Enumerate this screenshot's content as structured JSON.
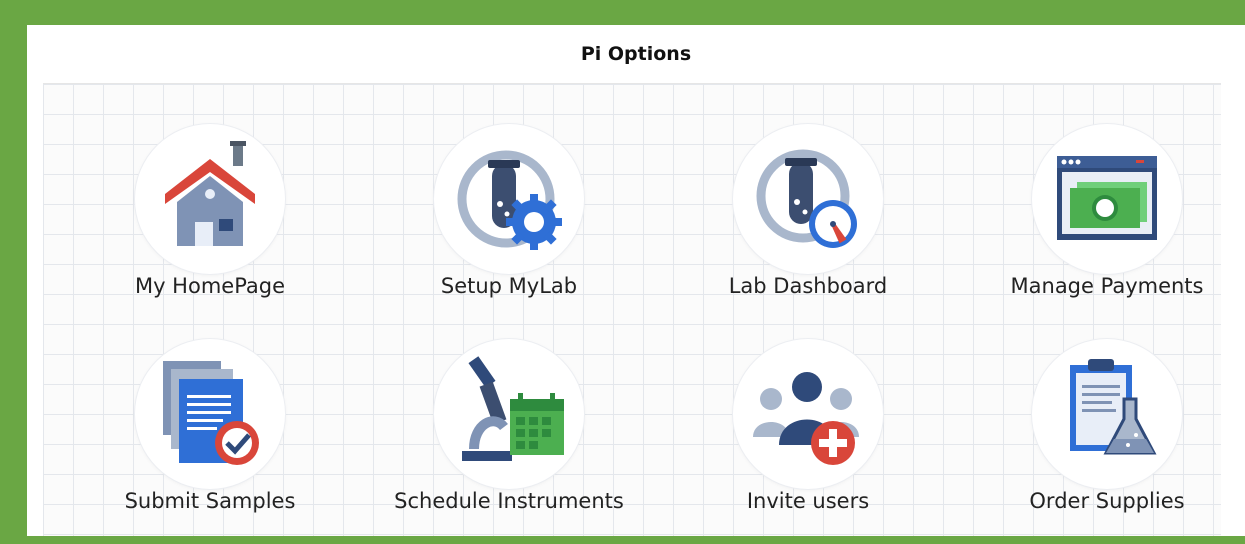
{
  "panel": {
    "title": "Pi Options"
  },
  "options": [
    {
      "label": "My HomePage",
      "icon": "house-icon"
    },
    {
      "label": "Setup MyLab",
      "icon": "lab-setup-gear-icon"
    },
    {
      "label": "Lab Dashboard",
      "icon": "lab-dashboard-gauge-icon"
    },
    {
      "label": "Manage Payments",
      "icon": "payment-window-icon"
    },
    {
      "label": "Submit Samples",
      "icon": "documents-check-icon"
    },
    {
      "label": "Schedule Instruments",
      "icon": "microscope-calendar-icon"
    },
    {
      "label": "Invite users",
      "icon": "users-add-icon"
    },
    {
      "label": "Order Supplies",
      "icon": "clipboard-flask-icon"
    }
  ],
  "colors": {
    "frame": "#6aa744",
    "accent_blue": "#2f6fd6",
    "accent_red": "#d9463a",
    "green": "#4caf50"
  }
}
